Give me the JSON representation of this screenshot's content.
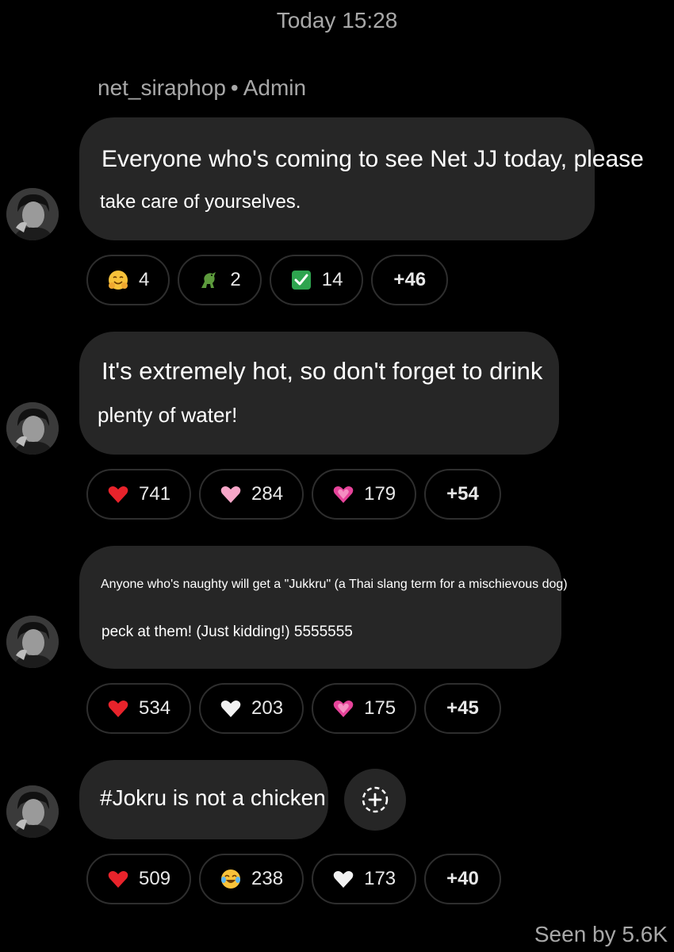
{
  "timestamp": "Today 15:28",
  "sender": {
    "name": "net_siraphop",
    "separator": "•",
    "role": "Admin"
  },
  "messages": [
    {
      "lines": [
        "Everyone who's coming to see Net JJ today, please",
        "take care of yourselves."
      ],
      "reactions": [
        {
          "emoji": "hugging-face-icon",
          "count": "4"
        },
        {
          "emoji": "dinosaur-icon",
          "count": "2"
        },
        {
          "emoji": "check-mark-icon",
          "count": "14"
        }
      ],
      "more": "+46"
    },
    {
      "lines": [
        "It's extremely hot, so don't forget to drink",
        "plenty of water!"
      ],
      "reactions": [
        {
          "emoji": "red-heart-icon",
          "count": "741"
        },
        {
          "emoji": "pink-heart-icon",
          "count": "284"
        },
        {
          "emoji": "sparkling-heart-icon",
          "count": "179"
        }
      ],
      "more": "+54"
    },
    {
      "lines": [
        "Anyone who's naughty will get a \"Jukkru\" (a Thai slang term for a mischievous dog)",
        "peck at them! (Just kidding!) 5555555"
      ],
      "reactions": [
        {
          "emoji": "red-heart-icon",
          "count": "534"
        },
        {
          "emoji": "white-heart-icon",
          "count": "203"
        },
        {
          "emoji": "sparkling-heart-icon",
          "count": "175"
        }
      ],
      "more": "+45"
    },
    {
      "lines": [
        "#Jokru is not a chicken"
      ],
      "reactions": [
        {
          "emoji": "red-heart-icon",
          "count": "509"
        },
        {
          "emoji": "tears-of-joy-icon",
          "count": "238"
        },
        {
          "emoji": "white-heart-icon",
          "count": "173"
        }
      ],
      "more": "+40"
    }
  ],
  "seen": "Seen by 5.6K"
}
